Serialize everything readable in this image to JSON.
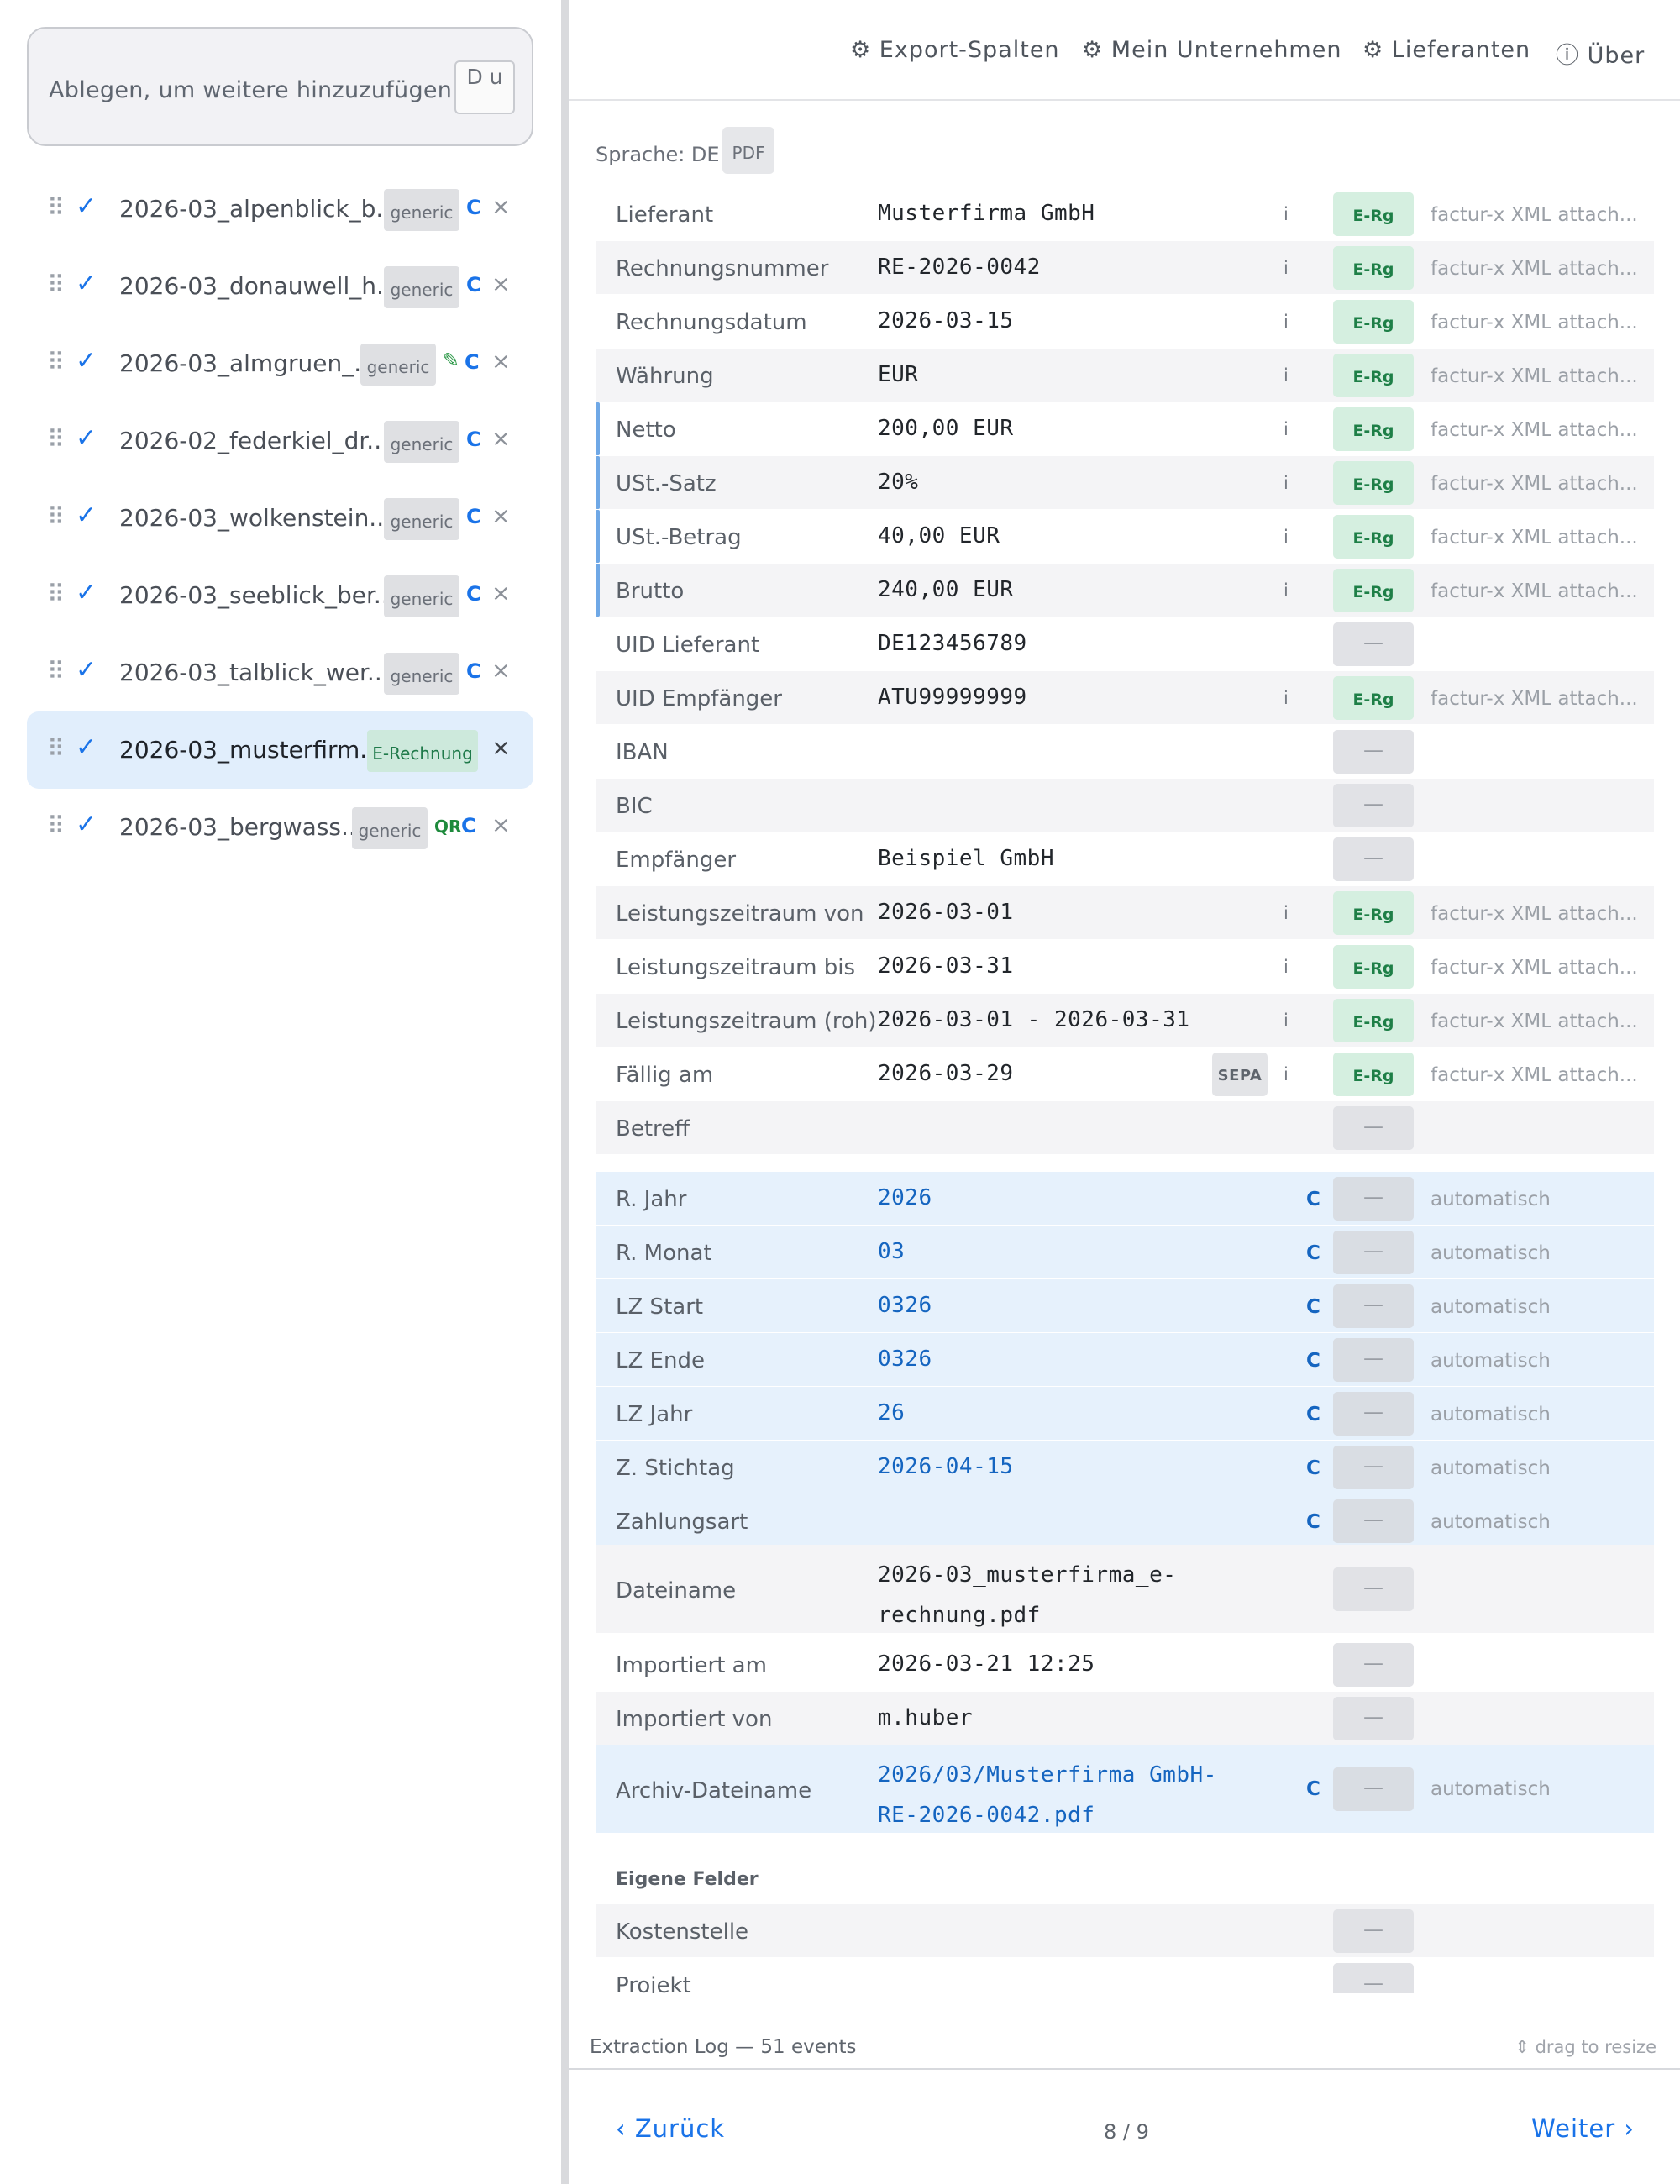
{
  "sidebar": {
    "dropzone_text": "Ablegen, um weitere hinzuzufügen",
    "dropzone_button": "D u",
    "files": [
      {
        "name": "2026-03_alpenblick_b...",
        "tag": "generic",
        "flags": [
          "C"
        ],
        "selected": false
      },
      {
        "name": "2026-03_donauwell_h...",
        "tag": "generic",
        "flags": [
          "C"
        ],
        "selected": false
      },
      {
        "name": "2026-03_almgruen_...",
        "tag": "generic",
        "flags": [
          "edit",
          "C"
        ],
        "selected": false
      },
      {
        "name": "2026-02_federkiel_dr...",
        "tag": "generic",
        "flags": [
          "C"
        ],
        "selected": false
      },
      {
        "name": "2026-03_wolkenstein...",
        "tag": "generic",
        "flags": [
          "C"
        ],
        "selected": false
      },
      {
        "name": "2026-03_seeblick_ber...",
        "tag": "generic",
        "flags": [
          "C"
        ],
        "selected": false
      },
      {
        "name": "2026-03_talblick_wer...",
        "tag": "generic",
        "flags": [
          "C"
        ],
        "selected": false
      },
      {
        "name": "2026-03_musterfirm...",
        "tag": "E-Rechnung",
        "flags": [],
        "selected": true
      },
      {
        "name": "2026-03_bergwass...",
        "tag": "generic",
        "flags": [
          "QR",
          "C"
        ],
        "selected": false
      }
    ],
    "check_glyph": "✓",
    "grip_glyph": "⠿",
    "remove_glyph": "×",
    "edit_glyph": "✎"
  },
  "nav": {
    "export_columns": "⚙ Export-Spalten",
    "my_company": "⚙ Mein Unternehmen",
    "suppliers": "⚙ Lieferanten",
    "about": "ⓘ Über"
  },
  "toolbar": {
    "language_label": "Sprache: DE",
    "pdf_button": "PDF"
  },
  "fields": [
    {
      "label": "Lieferant",
      "value": "Musterfirma GmbH",
      "info": "i",
      "badge": "E-Rg",
      "source": "factur-x XML attach..."
    },
    {
      "label": "Rechnungsnummer",
      "value": "RE-2026-0042",
      "info": "i",
      "badge": "E-Rg",
      "source": "factur-x XML attach..."
    },
    {
      "label": "Rechnungsdatum",
      "value": "2026-03-15",
      "info": "i",
      "badge": "E-Rg",
      "source": "factur-x XML attach..."
    },
    {
      "label": "Währung",
      "value": "EUR",
      "info": "i",
      "badge": "E-Rg",
      "source": "factur-x XML attach..."
    },
    {
      "label": "Netto",
      "value": "200,00 EUR",
      "info": "i",
      "badge": "E-Rg",
      "source": "factur-x XML attach..."
    },
    {
      "label": "USt.-Satz",
      "value": "20%",
      "info": "i",
      "badge": "E-Rg",
      "source": "factur-x XML attach..."
    },
    {
      "label": "USt.-Betrag",
      "value": "40,00 EUR",
      "info": "i",
      "badge": "E-Rg",
      "source": "factur-x XML attach..."
    },
    {
      "label": "Brutto",
      "value": "240,00 EUR",
      "info": "i",
      "badge": "E-Rg",
      "source": "factur-x XML attach..."
    },
    {
      "label": "UID Lieferant",
      "value": "DE123456789",
      "badge": "—"
    },
    {
      "label": "UID Empfänger",
      "value": "ATU99999999",
      "info": "i",
      "badge": "E-Rg",
      "source": "factur-x XML attach..."
    },
    {
      "label": "IBAN",
      "value": "",
      "badge": "—"
    },
    {
      "label": "BIC",
      "value": "",
      "badge": "—"
    },
    {
      "label": "Empfänger",
      "value": "Beispiel GmbH",
      "badge": "—"
    },
    {
      "label": "Leistungszeitraum von",
      "value": "2026-03-01",
      "info": "i",
      "badge": "E-Rg",
      "source": "factur-x XML attach..."
    },
    {
      "label": "Leistungszeitraum bis",
      "value": "2026-03-31",
      "info": "i",
      "badge": "E-Rg",
      "source": "factur-x XML attach..."
    },
    {
      "label": "Leistungszeitraum (roh)",
      "value": "2026-03-01 - 2026-03-31",
      "info": "i",
      "badge": "E-Rg",
      "source": "factur-x XML attach..."
    },
    {
      "label": "Fällig am",
      "value": "2026-03-29",
      "sepa": "SEPA",
      "info": "i",
      "badge": "E-Rg",
      "source": "factur-x XML attach..."
    },
    {
      "label": "Betreff",
      "value": "",
      "badge": "—"
    }
  ],
  "computed_fields": [
    {
      "label": "R. Jahr",
      "value": "2026",
      "flag": "C",
      "badge": "—",
      "source": "automatisch"
    },
    {
      "label": "R. Monat",
      "value": "03",
      "flag": "C",
      "badge": "—",
      "source": "automatisch"
    },
    {
      "label": "LZ Start",
      "value": "0326",
      "flag": "C",
      "badge": "—",
      "source": "automatisch"
    },
    {
      "label": "LZ Ende",
      "value": "0326",
      "flag": "C",
      "badge": "—",
      "source": "automatisch"
    },
    {
      "label": "LZ Jahr",
      "value": "26",
      "flag": "C",
      "badge": "—",
      "source": "automatisch"
    },
    {
      "label": "Z. Stichtag",
      "value": "2026-04-15",
      "flag": "C",
      "badge": "—",
      "source": "automatisch"
    },
    {
      "label": "Zahlungsart",
      "value": "",
      "flag": "C",
      "badge": "—",
      "source": "automatisch"
    }
  ],
  "meta_fields": {
    "filename_label": "Dateiname",
    "filename_value": "2026-03_musterfirma_e-rechnung.pdf",
    "imported_at_label": "Importiert am",
    "imported_at_value": "2026-03-21 12:25",
    "imported_by_label": "Importiert von",
    "imported_by_value": "m.huber",
    "archive_label": "Archiv-Dateiname",
    "archive_value": "2026/03/Musterfirma GmbH-RE-2026-0042.pdf",
    "archive_flag": "C",
    "archive_source": "automatisch",
    "dash": "—"
  },
  "custom_fields": {
    "title": "Eigene Felder",
    "fields": [
      {
        "label": "Kostenstelle",
        "badge": "—"
      },
      {
        "label": "Projekt",
        "badge": "—"
      }
    ]
  },
  "log": {
    "title": "Extraction Log — 51 events",
    "resize_hint": "⇕ drag to resize"
  },
  "pagination": {
    "back": "‹ Zurück",
    "position": "8 / 9",
    "next": "Weiter ›"
  },
  "colors": {
    "accent": "#1a73e8",
    "erg_badge_bg": "#d5efe0",
    "erg_badge_text": "#1e7f47",
    "selected_row_bg": "#e1eefc",
    "auto_row_bg": "#e6f1fc"
  }
}
